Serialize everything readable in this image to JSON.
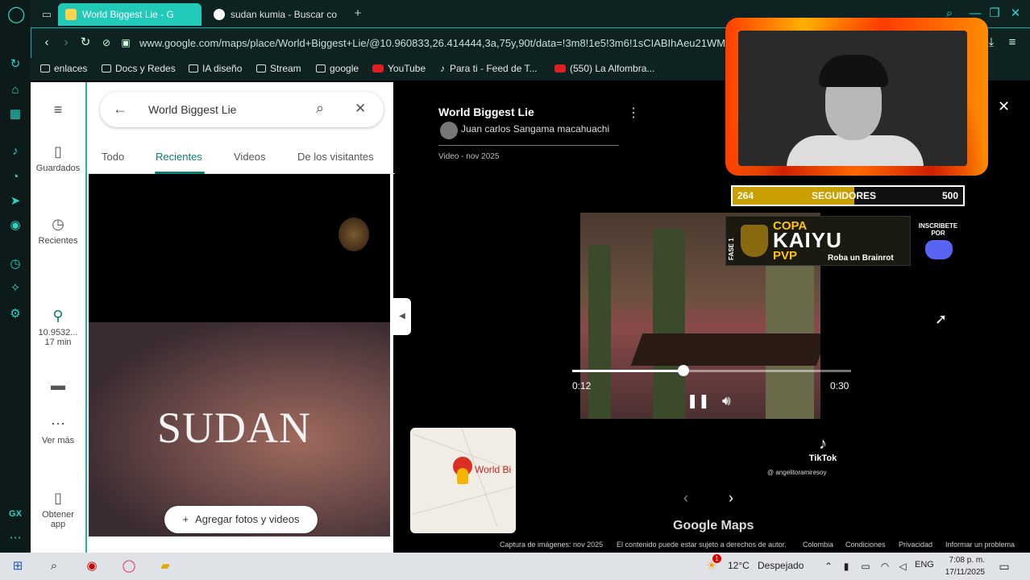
{
  "browser": {
    "tabs": [
      {
        "label": "World Biggest Lie - G",
        "active": true
      },
      {
        "label": "sudan kumia - Buscar co",
        "active": false
      }
    ],
    "new_tab_label": "+",
    "url": "www.google.com/maps/place/World+Biggest+Lie/@10.960833,26.414444,3a,75y,90t/data=!3m8!1e5!3m6!1sCIABIhAeu21WM2",
    "bookmarks": [
      {
        "label": "enlaces",
        "icon": "folder-icon"
      },
      {
        "label": "Docs y Redes",
        "icon": "folder-icon"
      },
      {
        "label": "IA diseño",
        "icon": "folder-icon"
      },
      {
        "label": "Stream",
        "icon": "folder-icon"
      },
      {
        "label": "google",
        "icon": "folder-icon"
      },
      {
        "label": "YouTube",
        "icon": "youtube-icon"
      },
      {
        "label": "Para ti - Feed de T...",
        "icon": "tiktok-icon"
      },
      {
        "label": "(550) La Alfombra...",
        "icon": "youtube-icon"
      }
    ]
  },
  "maps_rail": {
    "saved": "Guardados",
    "recent": "Recientes",
    "coords": "10.9532...",
    "duration": "17 min",
    "more": "Ver más",
    "get_app": "Obtener app"
  },
  "maps_panel": {
    "search_value": "World Biggest Lie",
    "tabs": [
      "Todo",
      "Recientes",
      "Videos",
      "De los visitantes"
    ],
    "selected_tab": "Recientes",
    "video_overlay_text": "SUDAN",
    "add_button": "Agregar fotos y videos"
  },
  "viewer": {
    "title": "World Biggest Lie",
    "author": "Juan carlos Sangama macahuachi",
    "meta": "Video - nov 2025",
    "time_current": "0:12",
    "time_total": "0:30",
    "progress": 0.4,
    "mini_map_label": "World Bi",
    "brand": "Google Maps",
    "tiktok_label": "TikTok",
    "tiktok_handle": "@ angelitoramiresoy",
    "footer": [
      "Captura de imágenes: nov 2025",
      "El contenido puede estar sujeto a derechos de autor.",
      "Colombia",
      "Condiciones",
      "Privacidad",
      "Informar un problema"
    ]
  },
  "stream_overlay": {
    "followers_current": "264",
    "followers_label": "SEGUIDORES",
    "followers_goal": "500",
    "followers_fraction": 0.528,
    "banner_phase": "FASE 1",
    "banner_line1": "COPA",
    "banner_line2": "KAIYU",
    "banner_line3": "PVP",
    "banner_sub": "Roba un Brainrot",
    "inscribete": "INSCRIBETE POR"
  },
  "taskbar": {
    "temperature": "12°C",
    "weather": "Despejado",
    "lang": "ENG",
    "time": "7:08 p. m.",
    "date": "17/11/2025",
    "notification_count": "1"
  },
  "colors": {
    "opera_accent": "#20c9b8",
    "maps_teal": "#0b7d74",
    "followers_bar": "#c9a000"
  }
}
